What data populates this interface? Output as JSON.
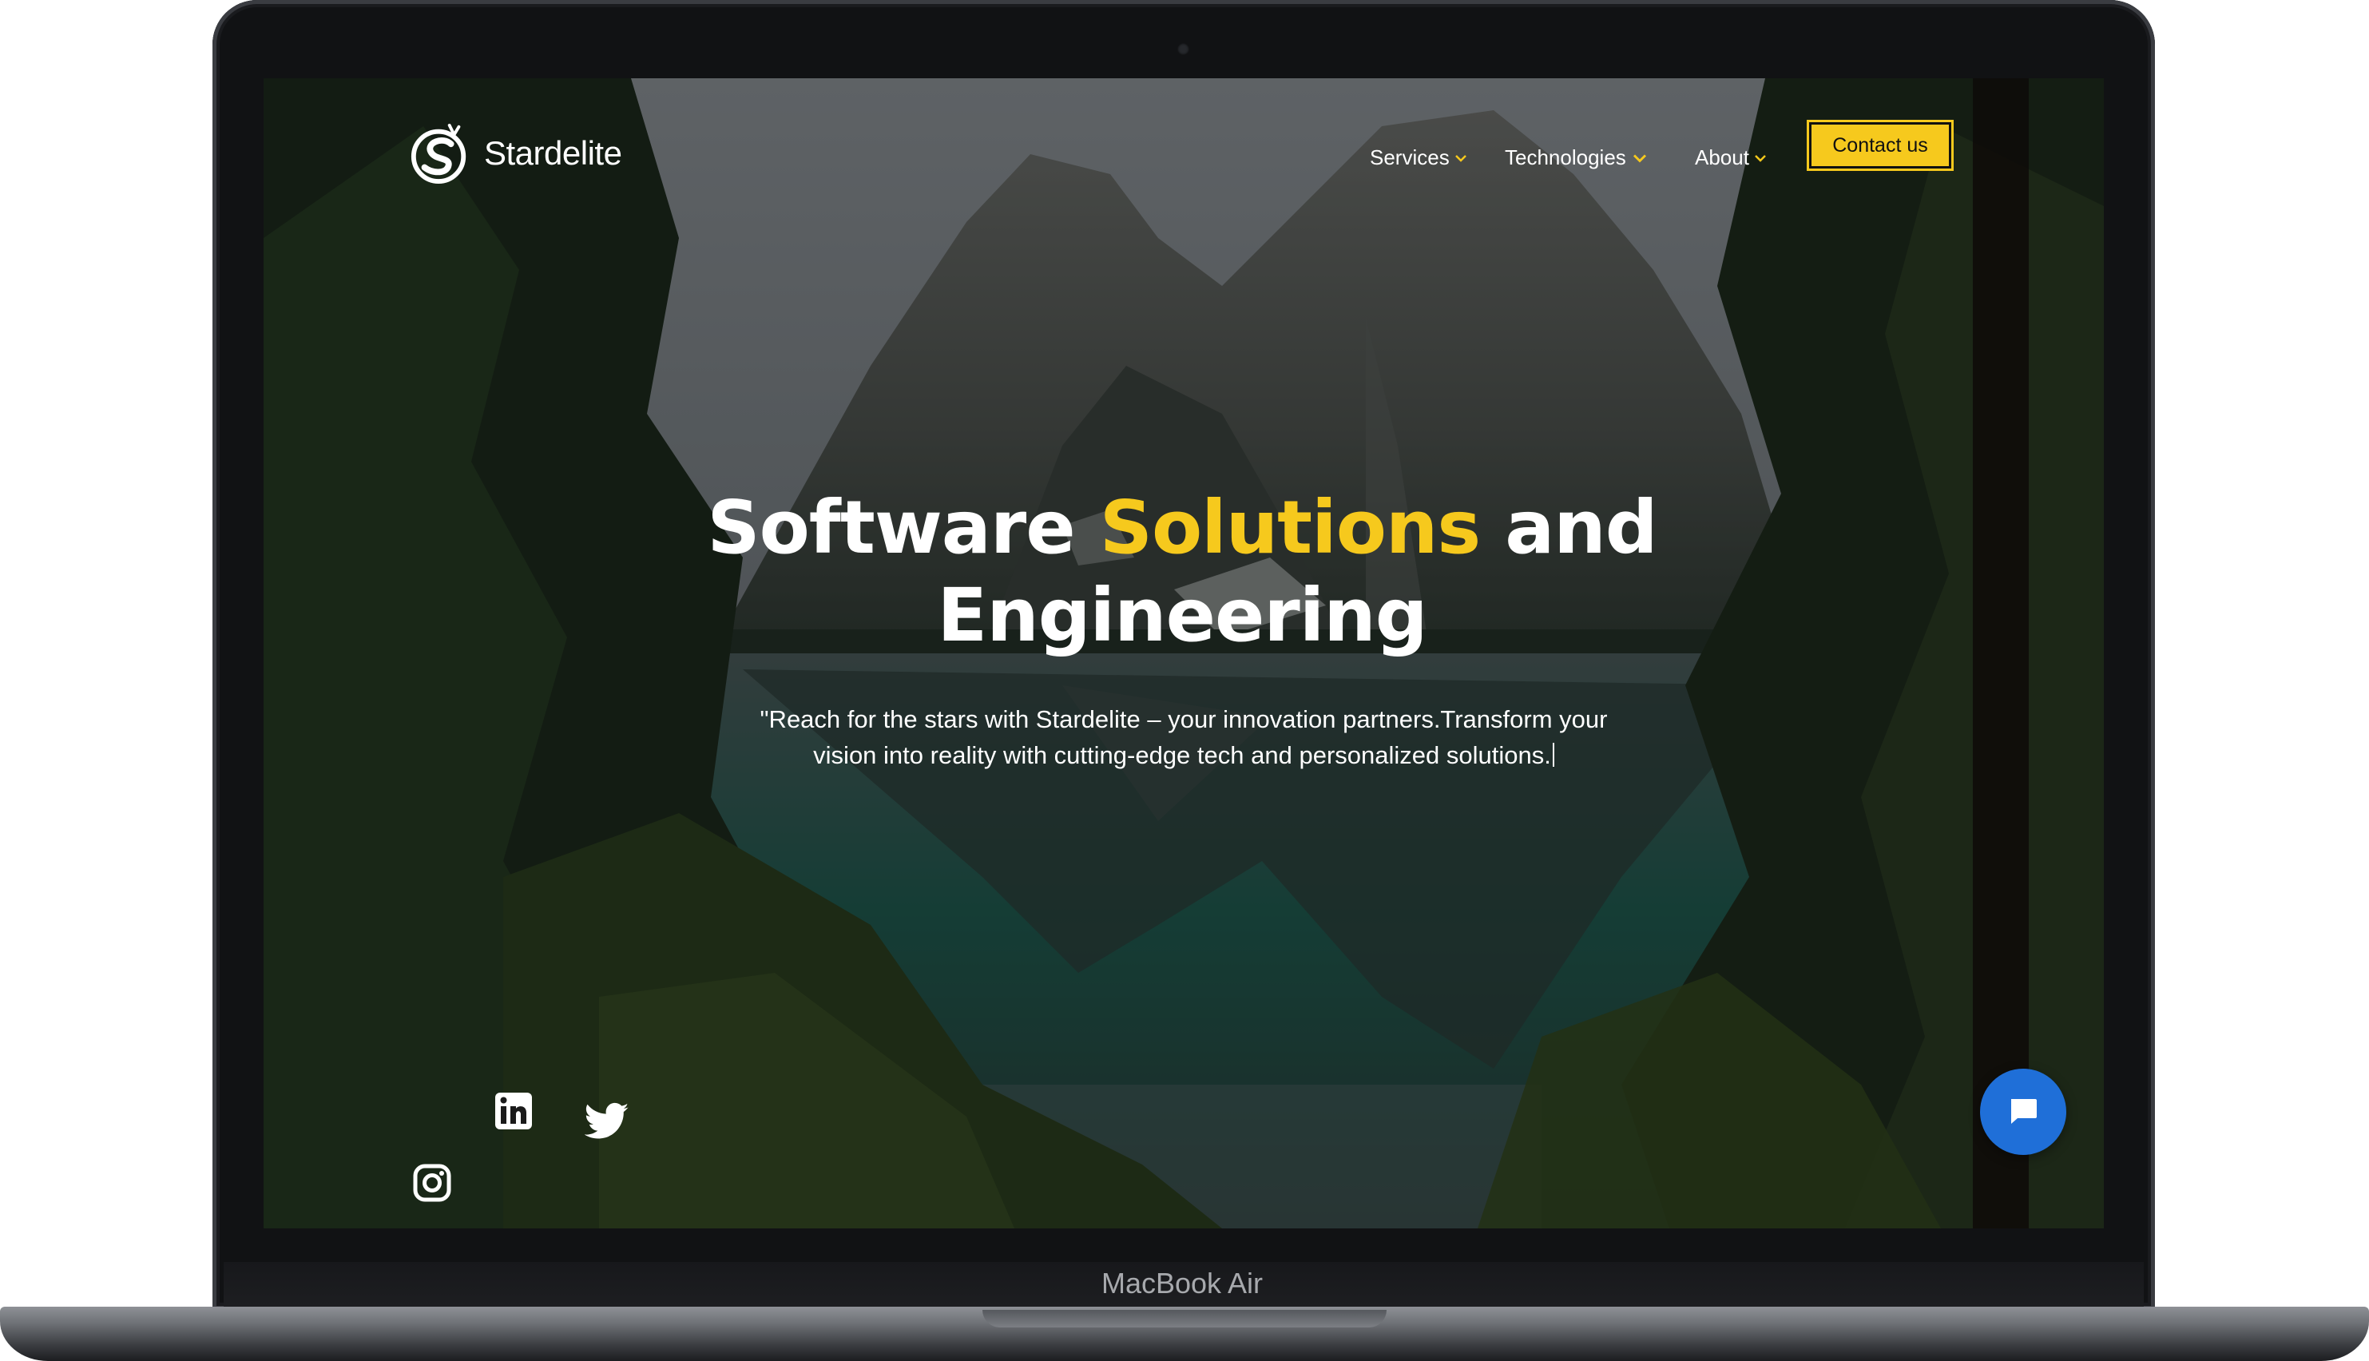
{
  "device": {
    "model_label": "MacBook Air"
  },
  "brand": {
    "name": "Stardelite",
    "logo_icon": "stardelite-s-logo-icon"
  },
  "nav": {
    "items": [
      {
        "label": "Services",
        "icon": "chevron-down-icon"
      },
      {
        "label": "Technologies",
        "icon": "chevron-down-icon"
      },
      {
        "label": "About",
        "icon": "chevron-down-icon"
      }
    ],
    "contact_label": "Contact us"
  },
  "hero": {
    "title_part1": "Software",
    "title_accent": "Solutions",
    "title_part2": "and",
    "title_line2": "Engineering",
    "subtitle_line1": "\"Reach for the stars with Stardelite – your innovation partners.Transform your",
    "subtitle_line2": "vision into reality with cutting-edge tech and personalized solutions."
  },
  "social": [
    {
      "name": "linkedin",
      "icon": "linkedin-icon"
    },
    {
      "name": "twitter",
      "icon": "twitter-icon"
    },
    {
      "name": "instagram",
      "icon": "instagram-icon"
    }
  ],
  "chat": {
    "icon": "chat-bubble-icon"
  },
  "colors": {
    "accent": "#f6c91d",
    "chat_button": "#1f6fd8",
    "text": "#ffffff",
    "laptop_frame": "#111214"
  }
}
